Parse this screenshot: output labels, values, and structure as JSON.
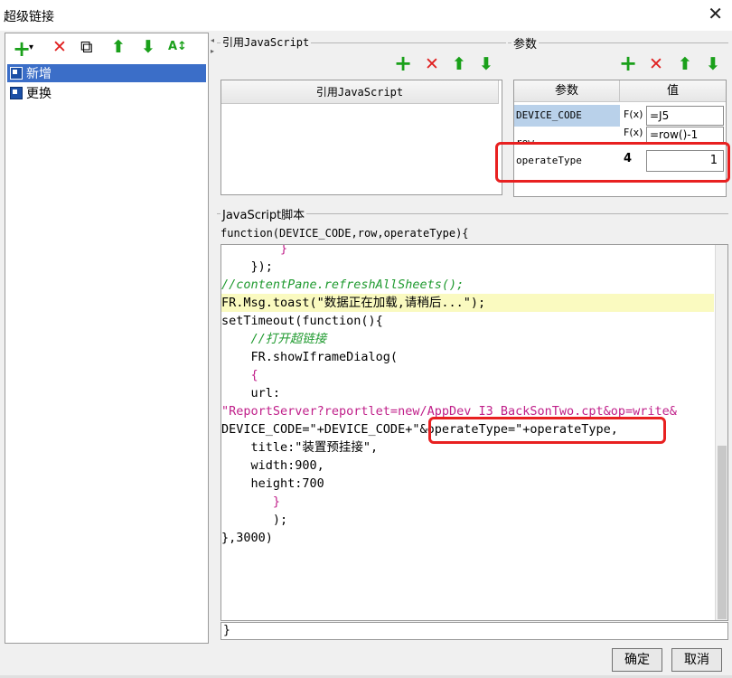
{
  "window": {
    "title": "超级链接",
    "close_glyph": "✕"
  },
  "left_toolbar": {
    "add": "+",
    "add_caret": "▾",
    "delete": "✕",
    "copy": "⧉",
    "up": "⬆",
    "down": "⬇",
    "sort": "A↕"
  },
  "tree": {
    "items": [
      {
        "label": "新增",
        "selected": true
      },
      {
        "label": "更换",
        "selected": false
      }
    ]
  },
  "ref_js": {
    "group_label": "引用JavaScript",
    "header": "引用JavaScript",
    "toolbar": {
      "add": "+",
      "delete": "✕",
      "up": "⬆",
      "down": "⬇"
    }
  },
  "params": {
    "group_label": "参数",
    "toolbar": {
      "add": "+",
      "delete": "✕",
      "up": "⬆",
      "down": "⬇"
    },
    "headers": {
      "name": "参数",
      "value": "值"
    },
    "rows": [
      {
        "name": "DEVICE_CODE",
        "type": "F(x)",
        "value": "=J5"
      },
      {
        "name": "row",
        "type": "F(x)",
        "value": "=row()-1"
      },
      {
        "name": "operateType",
        "type": "4",
        "value": "1"
      }
    ]
  },
  "script": {
    "group_label": "JavaScript脚本",
    "signature": "function(DEVICE_CODE,row,operateType){",
    "closing": "}",
    "lines": [
      "        }",
      "    });",
      "//contentPane.refreshAllSheets();",
      "FR.Msg.toast(\"数据正在加载,请稍后...\");",
      "setTimeout(function(){",
      "    //打开超链接",
      "    FR.showIframeDialog(",
      "    {",
      "    url:",
      "\"ReportServer?reportlet=new/AppDev_I3_BackSonTwo.cpt&op=write&",
      "DEVICE_CODE=\"+DEVICE_CODE+\"&operateType=\"+operateType,",
      "    title:\"装置预挂接\",",
      "    width:900,",
      "    height:700",
      "       }",
      "       );",
      "},3000)"
    ]
  },
  "buttons": {
    "ok": "确定",
    "cancel": "取消"
  },
  "colors": {
    "selection": "#3b6ec8",
    "highlight_box": "#e82020",
    "green_icon": "#1aa01a",
    "red_icon": "#e02020"
  }
}
